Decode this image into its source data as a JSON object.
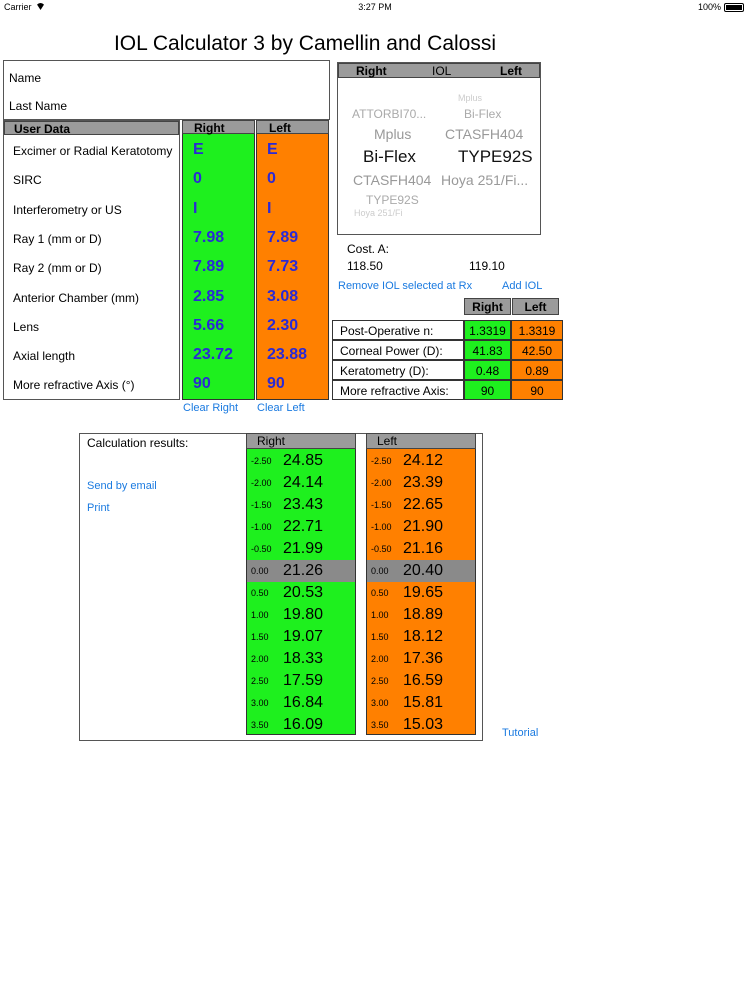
{
  "status": {
    "carrier": "Carrier",
    "time": "3:27 PM",
    "battery": "100%"
  },
  "title": "IOL Calculator 3 by Camellin and Calossi",
  "patient": {
    "name_label": "Name",
    "last_name_label": "Last Name"
  },
  "user_data": {
    "header": "User Data",
    "right_header": "Right",
    "left_header": "Left",
    "rows": [
      {
        "label": "Excimer or Radial Keratotomy",
        "right": "E",
        "left": "E"
      },
      {
        "label": "SIRC",
        "right": "0",
        "left": "0"
      },
      {
        "label": "Interferometry or US",
        "right": "I",
        "left": "I"
      },
      {
        "label": "Ray 1 (mm or D)",
        "right": "7.98",
        "left": "7.89"
      },
      {
        "label": "Ray 2 (mm or D)",
        "right": "7.89",
        "left": "7.73"
      },
      {
        "label": "Anterior Chamber (mm)",
        "right": "2.85",
        "left": "3.08"
      },
      {
        "label": "Lens",
        "right": "5.66",
        "left": "2.30"
      },
      {
        "label": "Axial length",
        "right": "23.72",
        "left": "23.88"
      },
      {
        "label": "More refractive Axis (°)",
        "right": "90",
        "left": "90"
      }
    ],
    "clear_right": "Clear Right",
    "clear_left": "Clear Left"
  },
  "iol_picker": {
    "header_right": "Right",
    "header_mid": "IOL",
    "header_left": "Left",
    "items": [
      "Mplus",
      "ATTORBI70...",
      "Bi-Flex",
      "Mplus",
      "CTASFH404",
      "Bi-Flex",
      "TYPE92S",
      "CTASFH404",
      "Hoya 251/Fi...",
      "TYPE92S",
      "Hoya 251/Fi"
    ]
  },
  "cost": {
    "label": "Cost. A:",
    "right": "118.50",
    "left": "119.10"
  },
  "actions": {
    "remove_iol": "Remove IOL selected at Rx",
    "add_iol": "Add IOL"
  },
  "postop": {
    "right_header": "Right",
    "left_header": "Left",
    "rows": [
      {
        "label": "Post-Operative n:",
        "right": "1.3319",
        "left": "1.3319"
      },
      {
        "label": "Corneal Power (D):",
        "right": "41.83",
        "left": "42.50"
      },
      {
        "label": "Keratometry (D):",
        "right": "0.48",
        "left": "0.89"
      },
      {
        "label": "More refractive Axis:",
        "right": "90",
        "left": "90"
      }
    ]
  },
  "results": {
    "label": "Calculation results:",
    "send_email": "Send by email",
    "print": "Print",
    "right_header": "Right",
    "left_header": "Left",
    "right": [
      {
        "off": "-2.50",
        "val": "24.85"
      },
      {
        "off": "-2.00",
        "val": "24.14"
      },
      {
        "off": "-1.50",
        "val": "23.43"
      },
      {
        "off": "-1.00",
        "val": "22.71"
      },
      {
        "off": "-0.50",
        "val": "21.99"
      },
      {
        "off": "0.00",
        "val": "21.26"
      },
      {
        "off": "0.50",
        "val": "20.53"
      },
      {
        "off": "1.00",
        "val": "19.80"
      },
      {
        "off": "1.50",
        "val": "19.07"
      },
      {
        "off": "2.00",
        "val": "18.33"
      },
      {
        "off": "2.50",
        "val": "17.59"
      },
      {
        "off": "3.00",
        "val": "16.84"
      },
      {
        "off": "3.50",
        "val": "16.09"
      }
    ],
    "left": [
      {
        "off": "-2.50",
        "val": "24.12"
      },
      {
        "off": "-2.00",
        "val": "23.39"
      },
      {
        "off": "-1.50",
        "val": "22.65"
      },
      {
        "off": "-1.00",
        "val": "21.90"
      },
      {
        "off": "-0.50",
        "val": "21.16"
      },
      {
        "off": "0.00",
        "val": "20.40"
      },
      {
        "off": "0.50",
        "val": "19.65"
      },
      {
        "off": "1.00",
        "val": "18.89"
      },
      {
        "off": "1.50",
        "val": "18.12"
      },
      {
        "off": "2.00",
        "val": "17.36"
      },
      {
        "off": "2.50",
        "val": "16.59"
      },
      {
        "off": "3.00",
        "val": "15.81"
      },
      {
        "off": "3.50",
        "val": "15.03"
      }
    ]
  },
  "tutorial": "Tutorial",
  "colors": {
    "right": "#1ef01e",
    "left": "#ff8000",
    "header": "#9b9b9b",
    "link": "#1a7ae0"
  }
}
